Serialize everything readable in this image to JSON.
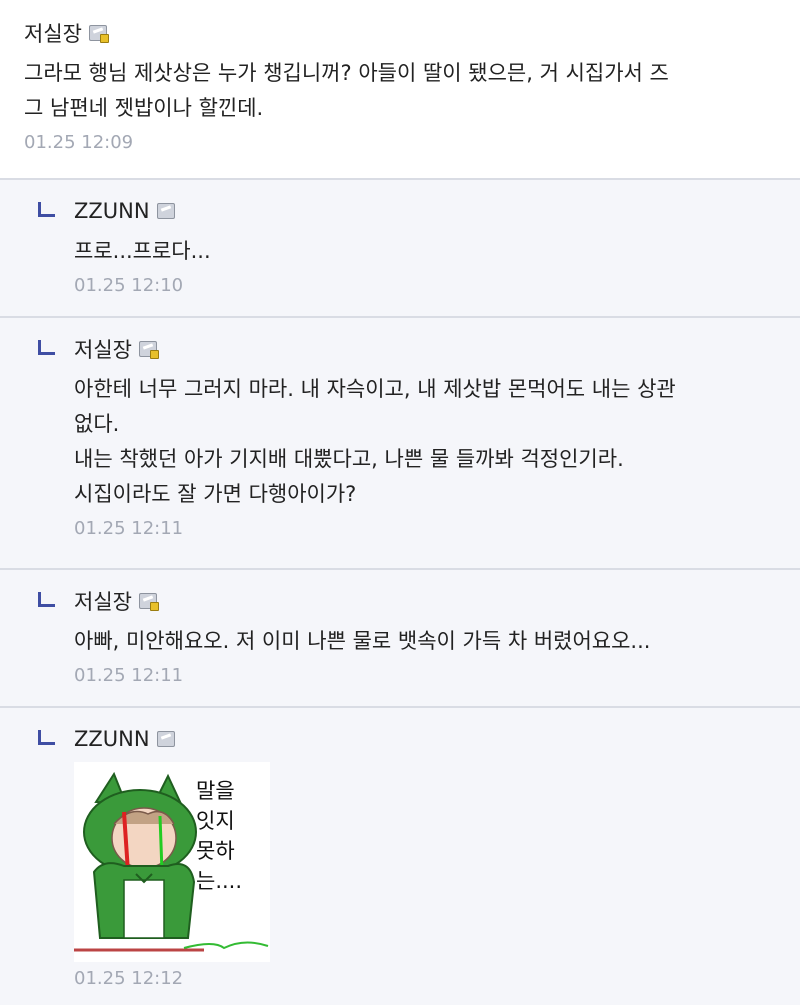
{
  "comments": [
    {
      "author": "저실장",
      "lines": [
        "그라모 행님 제삿상은 누가 챙깁니꺼? 아들이 딸이 됐으믄, 거 시집가서 즈",
        "그 남편네 젯밥이나 할낀데."
      ],
      "time": "01.25 12:09"
    },
    {
      "author": "ZZUNN",
      "lines": [
        "프로...프로다..."
      ],
      "time": "01.25 12:10"
    },
    {
      "author": "저실장",
      "lines": [
        "아한테 너무 그러지 마라. 내 자슥이고, 내 제삿밥 몬먹어도 내는 상관",
        "없다.",
        "내는 착했던 아가 기지배 대뿠다고, 나쁜 물 들까봐 걱정인기라.",
        "시집이라도 잘 가면 다행아이가?"
      ],
      "time": "01.25 12:11"
    },
    {
      "author": "저실장",
      "lines": [
        "아빠, 미안해요오. 저 이미 나쁜 물로 뱃속이 가득 차 버렸어요오..."
      ],
      "time": "01.25 12:11"
    },
    {
      "author": "ZZUNN",
      "sticker_lines": [
        "말을",
        "잇지",
        "못하",
        "는...."
      ],
      "time": "01.25 12:12"
    }
  ],
  "icons": {
    "level_icon": "level-badge-icon",
    "reply_icon": "reply-arrow-icon"
  },
  "colors": {
    "reply_mark": "#3f4ea3",
    "timestamp": "#a3a8b4",
    "reply_bg": "#f5f6fa"
  }
}
